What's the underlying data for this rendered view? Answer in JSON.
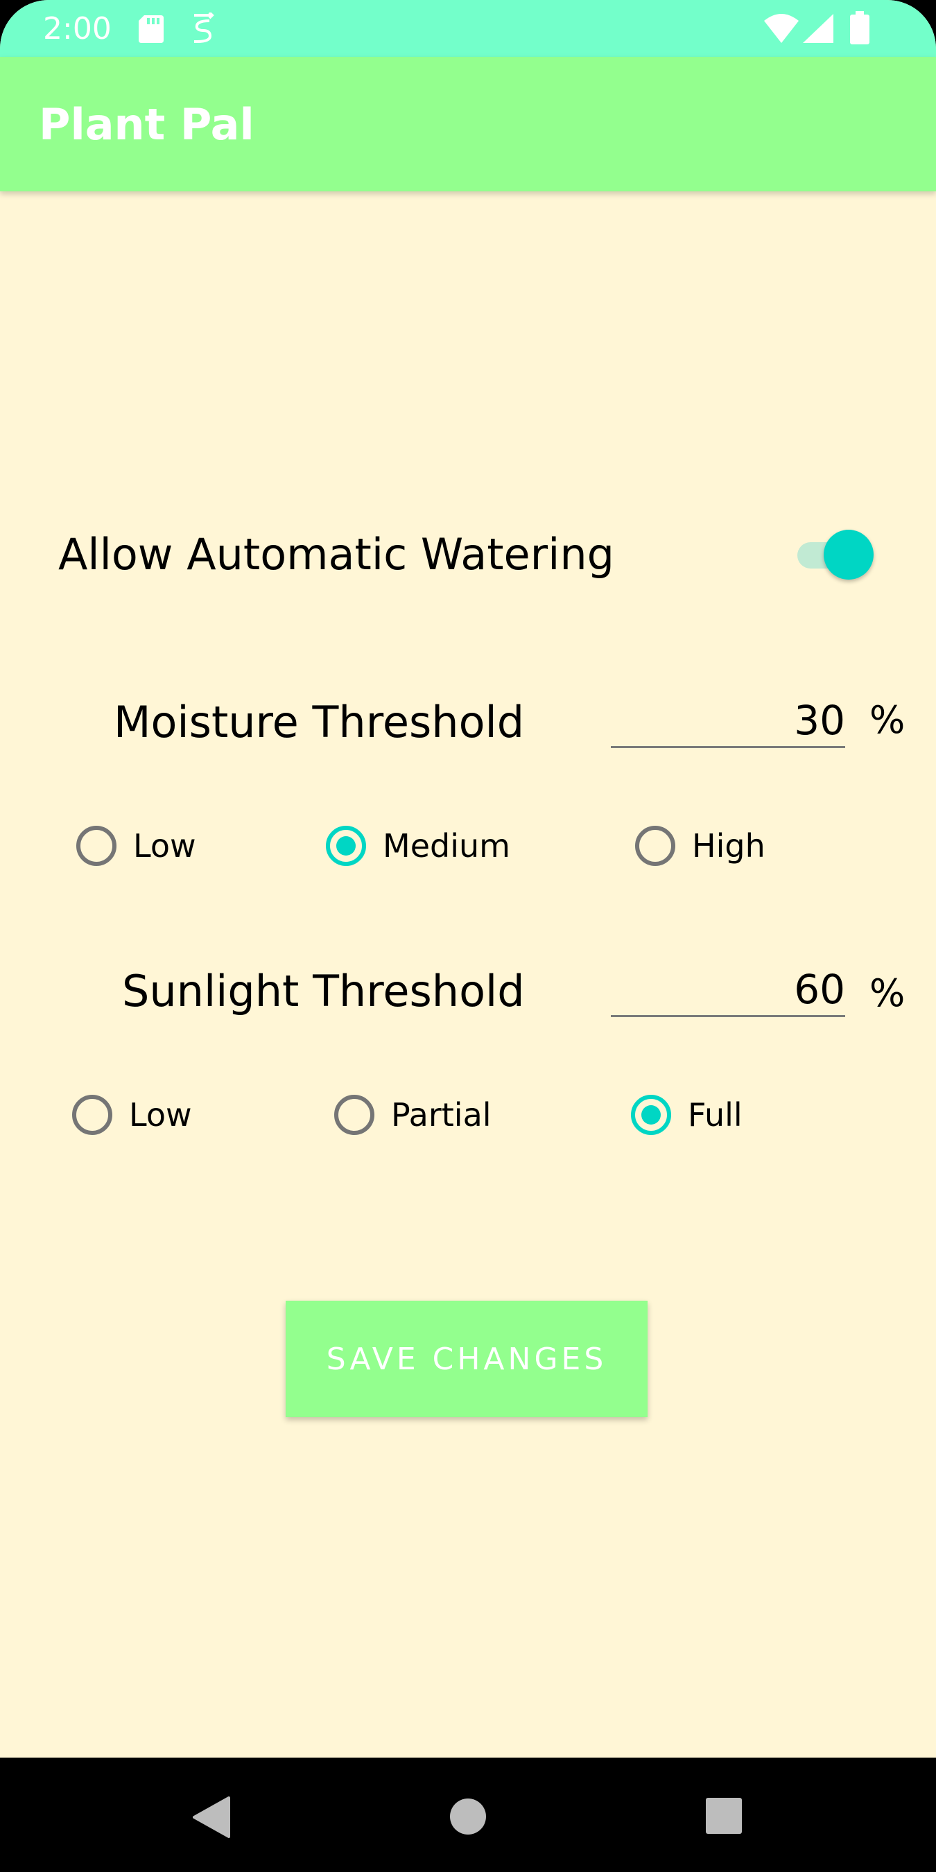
{
  "status_bar": {
    "time": "2:00",
    "icons": [
      "sd-card-icon",
      "sync-icon",
      "wifi-icon",
      "signal-icon",
      "battery-icon"
    ]
  },
  "app_bar": {
    "title": "Plant Pal"
  },
  "auto_watering": {
    "label": "Allow Automatic Watering",
    "enabled": true
  },
  "moisture": {
    "label": "Moisture Threshold",
    "value": "30",
    "unit": "%",
    "options": [
      {
        "label": "Low",
        "checked": false
      },
      {
        "label": "Medium",
        "checked": true
      },
      {
        "label": "High",
        "checked": false
      }
    ]
  },
  "sunlight": {
    "label": "Sunlight Threshold",
    "value": "60",
    "unit": "%",
    "options": [
      {
        "label": "Low",
        "checked": false
      },
      {
        "label": "Partial",
        "checked": false
      },
      {
        "label": "Full",
        "checked": true
      }
    ]
  },
  "save_button": {
    "label": "SAVE CHANGES"
  },
  "nav_bar": {
    "buttons": [
      "back-icon",
      "home-icon",
      "recents-icon"
    ]
  },
  "colors": {
    "status_bar": "#73FFCA",
    "app_bar": "#93FF8E",
    "background": "#FFF6D6",
    "accent": "#00D6C4"
  }
}
